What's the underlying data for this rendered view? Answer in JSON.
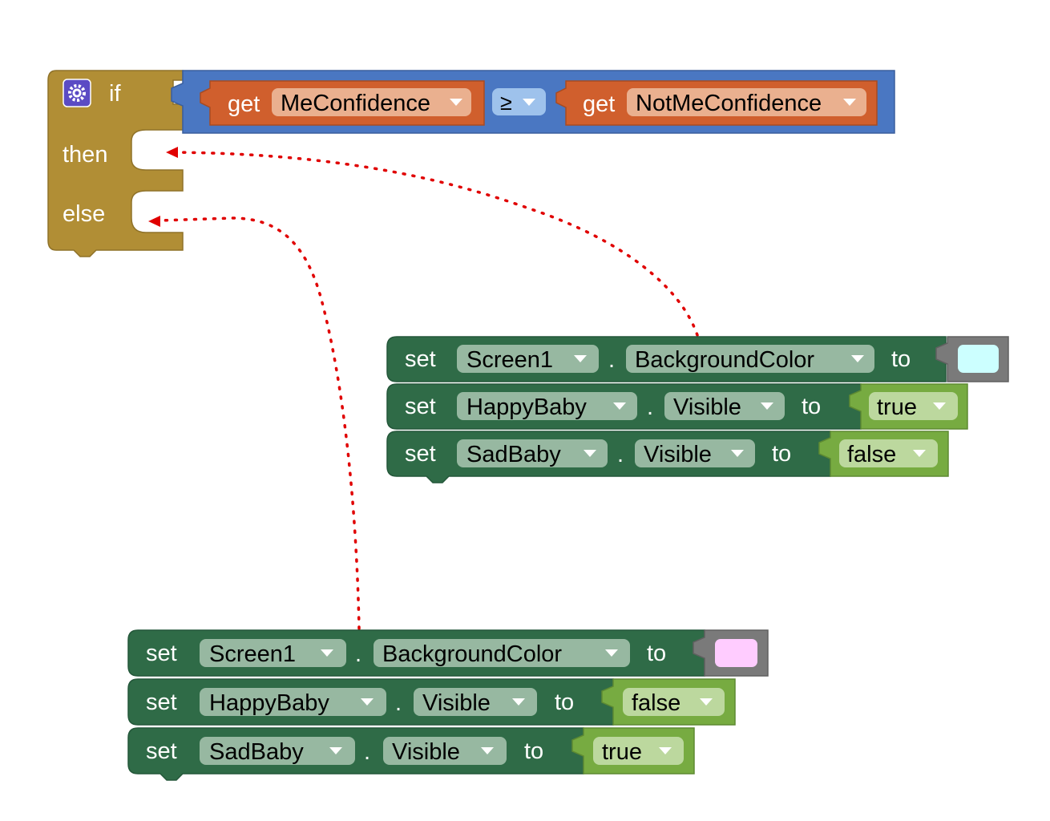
{
  "if_block": {
    "if_label": "if",
    "then_label": "then",
    "else_label": "else",
    "condition": {
      "left": {
        "keyword": "get",
        "variable": "MeConfidence"
      },
      "operator": "≥",
      "right": {
        "keyword": "get",
        "variable": "NotMeConfidence"
      }
    }
  },
  "then_group": [
    {
      "keyword": "set",
      "component": "Screen1",
      "property": "BackgroundColor",
      "to": "to",
      "value_type": "color",
      "color": "#ccffff"
    },
    {
      "keyword": "set",
      "component": "HappyBaby",
      "property": "Visible",
      "to": "to",
      "value_type": "boolean",
      "value": "true"
    },
    {
      "keyword": "set",
      "component": "SadBaby",
      "property": "Visible",
      "to": "to",
      "value_type": "boolean",
      "value": "false"
    }
  ],
  "else_group": [
    {
      "keyword": "set",
      "component": "Screen1",
      "property": "BackgroundColor",
      "to": "to",
      "value_type": "color",
      "color": "#ffccff"
    },
    {
      "keyword": "set",
      "component": "HappyBaby",
      "property": "Visible",
      "to": "to",
      "value_type": "boolean",
      "value": "false"
    },
    {
      "keyword": "set",
      "component": "SadBaby",
      "property": "Visible",
      "to": "to",
      "value_type": "boolean",
      "value": "true"
    }
  ],
  "colors": {
    "control": "#b18e35",
    "control_dark": "#8f7229",
    "gear_bg": "#5b4bc4",
    "logic_compare": "#4a77c2",
    "logic_dropdown": "#9ec2ec",
    "variable": "#d05f2d",
    "variable_dropdown": "#eab08f",
    "setter": "#2f6b47",
    "setter_dark": "#24573a",
    "setter_dropdown": "#97b8a1",
    "boolean": "#77ab41",
    "boolean_dropdown": "#bcd89e",
    "color_block": "#7a7a7a",
    "connector": "#e00000"
  }
}
